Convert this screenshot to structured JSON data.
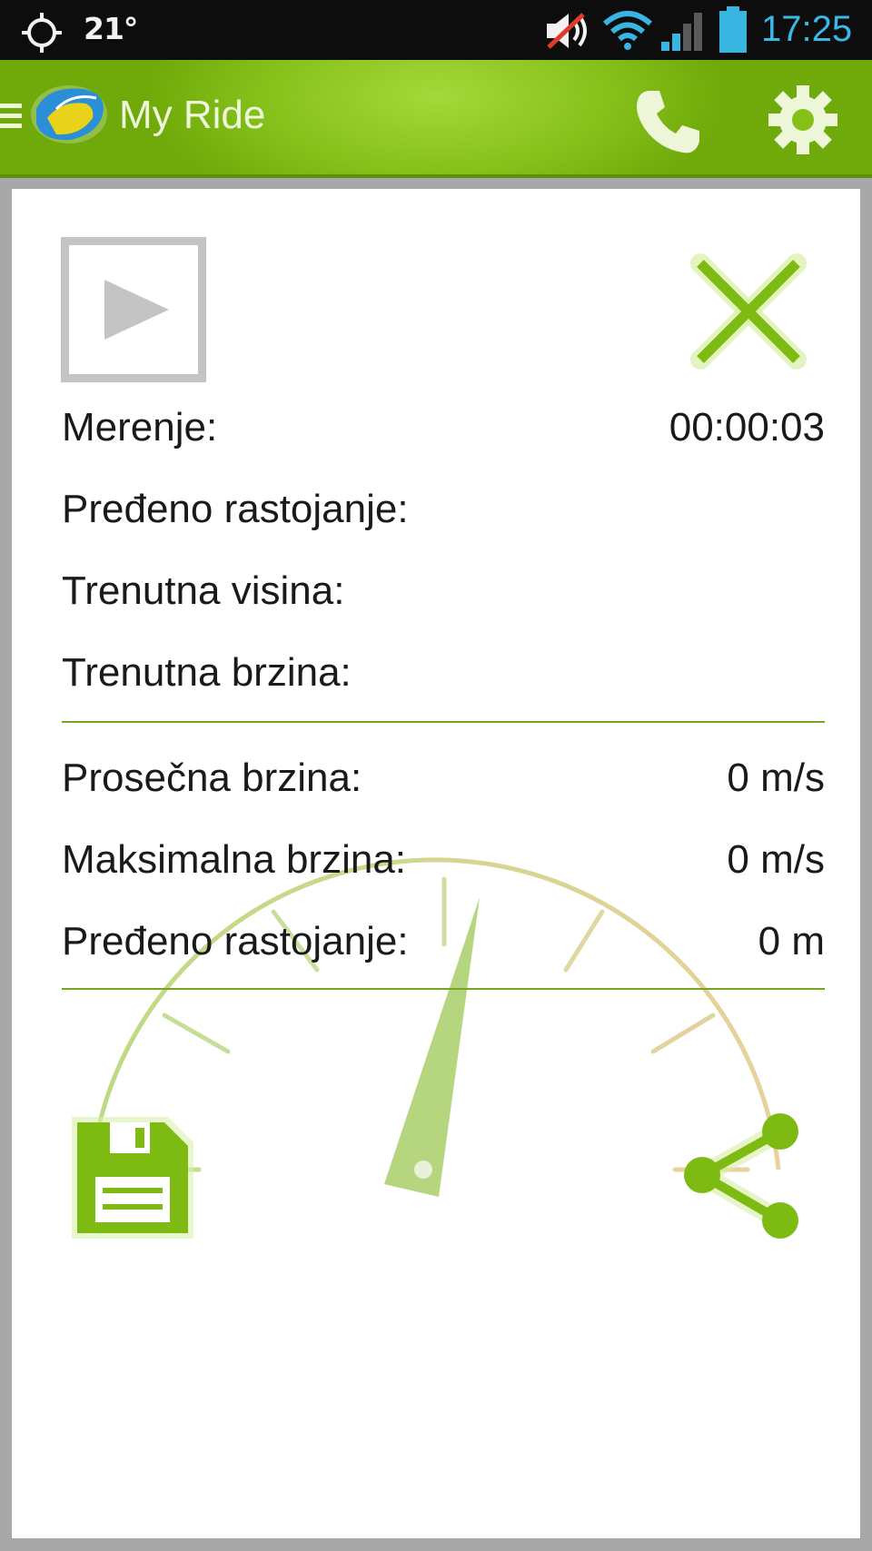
{
  "status_bar": {
    "temperature": "21°",
    "time": "17:25",
    "icons": [
      "gps-icon",
      "mute-icon",
      "wifi-icon",
      "signal-icon",
      "battery-icon"
    ]
  },
  "action_bar": {
    "title": "My Ride",
    "icons": [
      "menu-icon",
      "app-logo",
      "call-icon",
      "settings-icon"
    ],
    "color": "#86c01a"
  },
  "controls": {
    "icons": [
      "play-icon",
      "close-icon",
      "save-icon",
      "share-icon"
    ]
  },
  "current_stats": [
    {
      "label": "Merenje:",
      "value": "00:00:03"
    },
    {
      "label": "Pređeno rastojanje:",
      "value": ""
    },
    {
      "label": "Trenutna visina:",
      "value": ""
    },
    {
      "label": "Trenutna brzina:",
      "value": ""
    }
  ],
  "summary_stats": [
    {
      "label": "Prosečna brzina:",
      "value": "0 m/s"
    },
    {
      "label": "Maksimalna brzina:",
      "value": "0 m/s"
    },
    {
      "label": "Pređeno rastojanje:",
      "value": "0 m"
    }
  ],
  "colors": {
    "accent": "#7dbb12",
    "status_time": "#3bb9e6",
    "divider": "#78a51e"
  }
}
